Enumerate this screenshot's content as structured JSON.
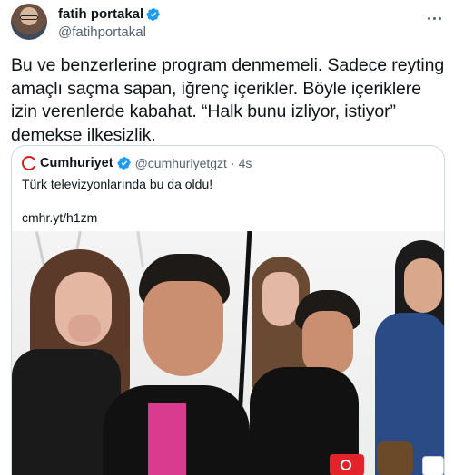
{
  "tweet": {
    "author_name": "fatih portakal",
    "author_handle": "@fatihportakal",
    "text": "Bu ve benzerlerine program denmemeli. Sadece reyting amaçlı saçma sapan, iğrenç içerikler. Böyle içeriklere izin verenlerde kabahat. “Halk bunu izliyor, istiyor” demekse ilkesizlik."
  },
  "quoted_tweet": {
    "author_name": "Cumhuriyet",
    "author_handle": "@cumhuriyetgzt",
    "separator": "·",
    "time": "4s",
    "text": "Türk televizyonlarında bu da oldu!",
    "link": "cmhr.yt/h1zm"
  },
  "icons": {
    "verified": "verified-badge-icon",
    "more": "more-options-icon",
    "publisher_logo": "cumhuriyet-logo-icon"
  },
  "colors": {
    "verified_blue": "#1d9bf0",
    "text": "#0f1419",
    "secondary_text": "#536471",
    "border": "#cfd9de",
    "brand_red": "#d71920"
  }
}
